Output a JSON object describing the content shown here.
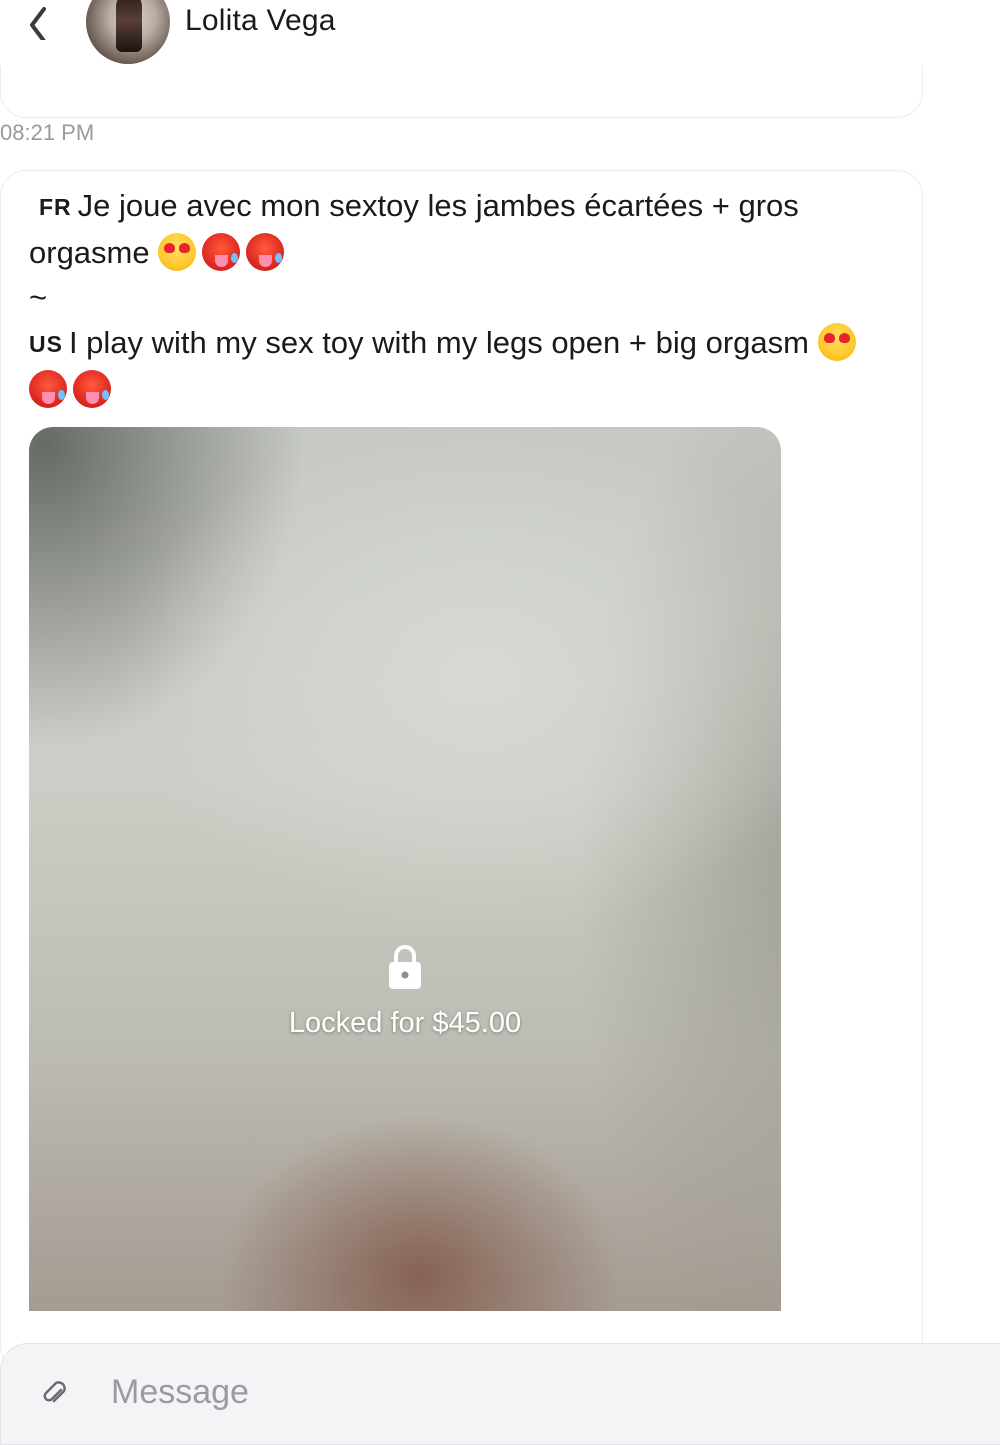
{
  "header": {
    "back_icon": "chevron-left-icon",
    "contact_name": "Lolita Vega"
  },
  "previous_message": {
    "timestamp": "08:21 PM"
  },
  "message": {
    "fr_flag": "FR",
    "fr_text": "Je joue avec mon sextoy les jambes écartées + gros orgasme",
    "separator": "~",
    "us_flag": "US",
    "us_text": "I play with my sex toy with my legs open + big orgasm",
    "emojis": [
      "smiling-face-with-heart-eyes",
      "hot-face",
      "hot-face"
    ],
    "media": {
      "lock_icon": "lock-icon",
      "locked_label": "Locked for $45.00"
    }
  },
  "composer": {
    "attach_icon": "paperclip-icon",
    "placeholder": "Message",
    "value": ""
  },
  "colors": {
    "text": "#1a1a1a",
    "timestamp": "#9a9a9a",
    "bubble_border": "#ececec",
    "composer_bg": "#f4f4f6"
  }
}
